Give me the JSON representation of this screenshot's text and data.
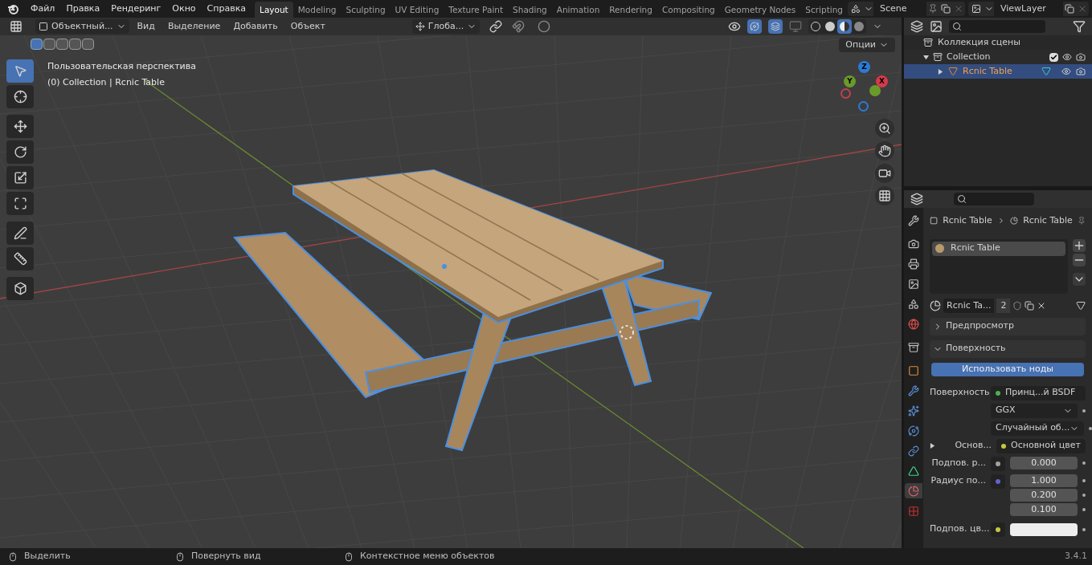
{
  "menu": [
    "Файл",
    "Правка",
    "Рендеринг",
    "Окно",
    "Справка"
  ],
  "workspaces": [
    {
      "label": "Layout",
      "selected": true
    },
    {
      "label": "Modeling",
      "selected": false
    },
    {
      "label": "Sculpting",
      "selected": false
    },
    {
      "label": "UV Editing",
      "selected": false
    },
    {
      "label": "Texture Paint",
      "selected": false
    },
    {
      "label": "Shading",
      "selected": false
    },
    {
      "label": "Animation",
      "selected": false
    },
    {
      "label": "Rendering",
      "selected": false
    },
    {
      "label": "Compositing",
      "selected": false
    },
    {
      "label": "Geometry Nodes",
      "selected": false
    },
    {
      "label": "Scripting",
      "selected": false
    }
  ],
  "scene": {
    "value": "Scene"
  },
  "view_layer": {
    "value": "ViewLayer"
  },
  "viewport": {
    "mode": "Объектный...",
    "menus": [
      "Вид",
      "Выделение",
      "Добавить",
      "Объект"
    ],
    "orientation": "Глоба...",
    "options": "Опции",
    "select_modes": [
      {
        "selected": true
      },
      {
        "selected": false
      },
      {
        "selected": false
      },
      {
        "selected": false
      },
      {
        "selected": false
      }
    ],
    "info": [
      "Пользовательская перспектива",
      "(0) Collection | Rcnic Table"
    ],
    "tools": [
      {
        "kind": "select",
        "selected": true
      },
      {
        "kind": "cursor",
        "selected": false
      },
      {
        "kind": "move",
        "selected": false
      },
      {
        "kind": "rotate",
        "selected": false
      },
      {
        "kind": "scale",
        "selected": false
      },
      {
        "kind": "transform",
        "selected": false
      },
      {
        "kind": "annotate",
        "selected": false
      },
      {
        "kind": "measure",
        "selected": false
      },
      {
        "kind": "add_cube",
        "selected": false
      }
    ],
    "shading": [
      {
        "kind": "wireframe",
        "selected": false
      },
      {
        "kind": "solid",
        "selected": false
      },
      {
        "kind": "material",
        "selected": true
      },
      {
        "kind": "rendered",
        "selected": false
      }
    ],
    "axes": [
      "Z",
      "Y",
      "X"
    ]
  },
  "outliner": {
    "rows": [
      {
        "label": "Коллекция сцены",
        "children": [
          {
            "label": "Collection",
            "checked": true,
            "expanded": true,
            "children": [
              {
                "label": "Rcnic Table",
                "selected": true,
                "expanded": false
              }
            ]
          }
        ]
      }
    ]
  },
  "properties": {
    "tabs": [
      {
        "kind": "tool",
        "selected": false
      },
      {
        "kind": "render",
        "selected": false
      },
      {
        "kind": "output",
        "selected": false
      },
      {
        "kind": "view_layer",
        "selected": false
      },
      {
        "kind": "scene",
        "selected": false
      },
      {
        "kind": "world",
        "selected": false
      },
      {
        "kind": "collection",
        "selected": false
      },
      {
        "kind": "object",
        "selected": false
      },
      {
        "kind": "modifiers",
        "selected": false
      },
      {
        "kind": "particles",
        "selected": false
      },
      {
        "kind": "physics",
        "selected": false
      },
      {
        "kind": "constraints",
        "selected": false
      },
      {
        "kind": "data",
        "selected": false
      },
      {
        "kind": "material",
        "selected": true
      },
      {
        "kind": "texture",
        "selected": false
      }
    ],
    "breadcrumb": [
      "Rcnic Table",
      "Rcnic Table"
    ],
    "slots": [
      {
        "label": "Rcnic Table",
        "selected": true
      }
    ],
    "material": {
      "name": "Rcnic Ta...",
      "users": "2"
    },
    "panels": [
      {
        "label": "Предпросмотр",
        "expanded": false
      },
      {
        "label": "Поверхность",
        "expanded": true
      }
    ],
    "use_nodes": "Использовать ноды",
    "fields": [
      {
        "kind": "link",
        "label": "Поверхность",
        "value": "Принц...й BSDF",
        "color": "#4caf50"
      },
      {
        "kind": "dropdown",
        "value": "GGX"
      },
      {
        "kind": "dropdown",
        "value": "Случайный об..."
      },
      {
        "kind": "link",
        "label": "Основ...",
        "value": "Основной цвет",
        "color": "#c7c73e",
        "expanded": false
      },
      {
        "kind": "number",
        "label": "Подпов. р...",
        "color": "#a1a1a1",
        "values": [
          "0.000"
        ]
      },
      {
        "kind": "number",
        "label": "Радиус по...",
        "color": "#6363c7",
        "values": [
          "1.000",
          "0.200",
          "0.100"
        ]
      },
      {
        "kind": "swatch",
        "label": "Подпов. цв...",
        "color": "#c7c73e"
      }
    ]
  },
  "status": [
    "Выделить",
    "Повернуть вид",
    "Контекстное меню объектов"
  ],
  "version": "3.4.1"
}
